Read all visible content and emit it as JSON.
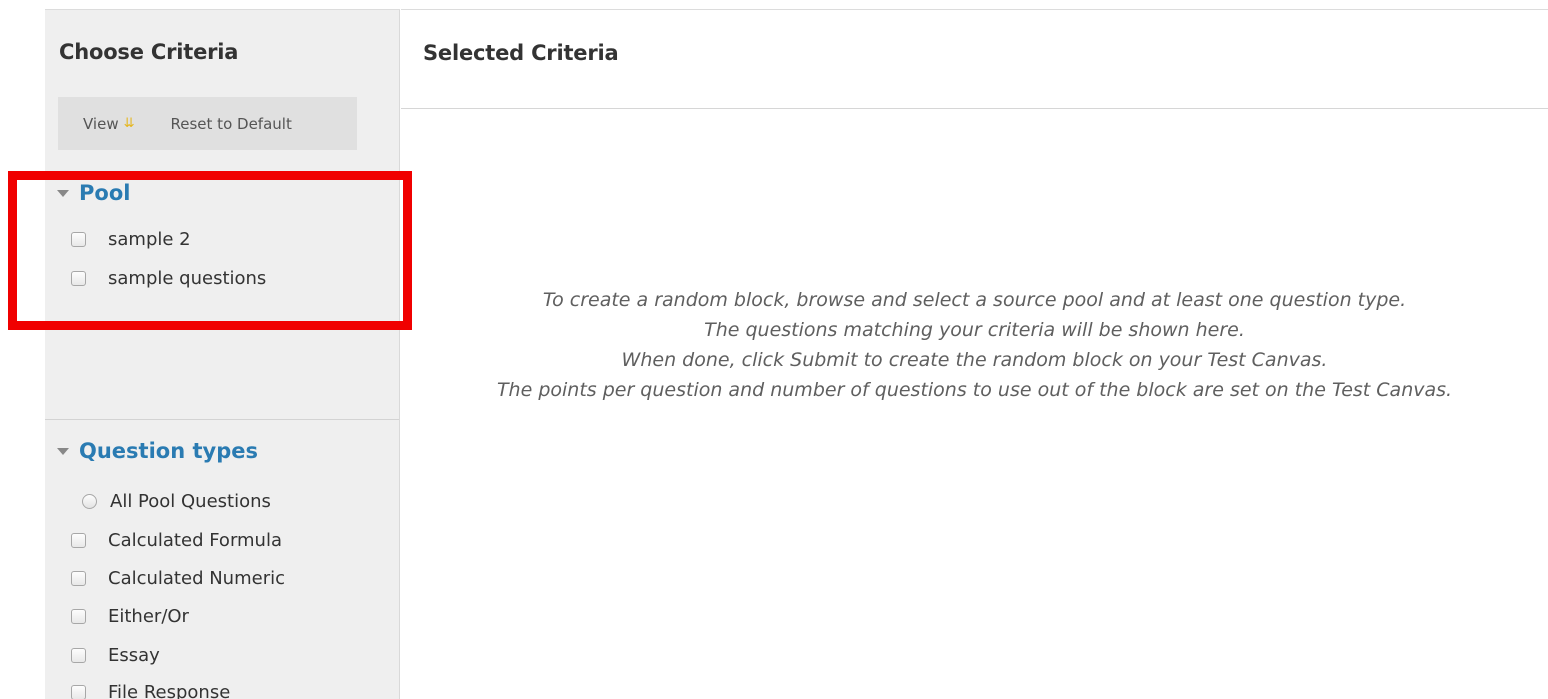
{
  "choose_criteria": {
    "title": "Choose Criteria",
    "toolbar": {
      "view_label": "View",
      "view_icon": "double-chevron-down-icon",
      "reset_label": "Reset to Default"
    },
    "pool": {
      "heading": "Pool",
      "items": [
        {
          "label": "sample 2",
          "checked": false
        },
        {
          "label": "sample questions",
          "checked": false
        }
      ]
    },
    "question_types": {
      "heading": "Question types",
      "all_option": {
        "label": "All Pool Questions",
        "selected": false
      },
      "items": [
        {
          "label": "Calculated Formula",
          "checked": false
        },
        {
          "label": "Calculated Numeric",
          "checked": false
        },
        {
          "label": "Either/Or",
          "checked": false
        },
        {
          "label": "Essay",
          "checked": false
        },
        {
          "label": "File Response",
          "checked": false
        }
      ]
    }
  },
  "selected_criteria": {
    "title": "Selected Criteria",
    "instructions": [
      "To create a random block, browse and select a source pool and at least one question type.",
      "The questions matching your criteria will be shown here.",
      "When done, click Submit to create the random block on your Test Canvas.",
      "The points per question and number of questions to use out of the block are set on the Test Canvas."
    ]
  },
  "colors": {
    "heading_link": "#2a7bb2",
    "highlight": "#f00000",
    "chevron": "#e5b61f",
    "panel_bg": "#efefef"
  }
}
